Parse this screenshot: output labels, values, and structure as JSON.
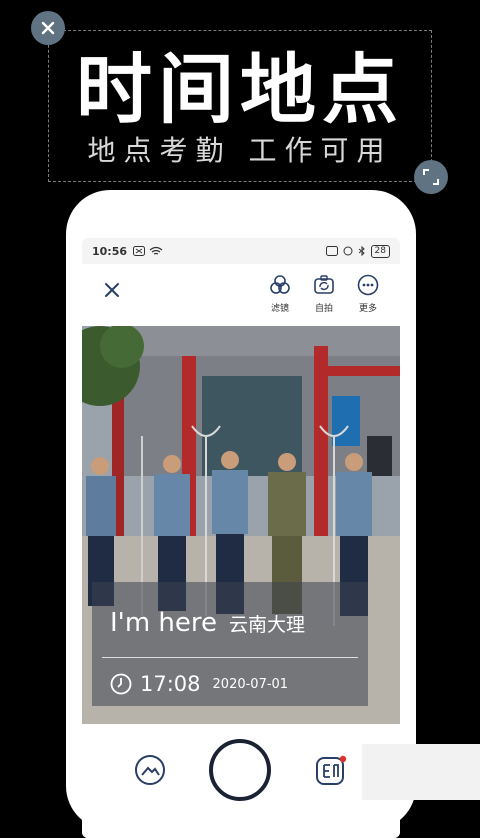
{
  "promo": {
    "title": "时间地点",
    "subtitle": "地点考勤 工作可用"
  },
  "status_bar": {
    "time": "10:56",
    "battery": "28"
  },
  "toolbar": {
    "filter_label": "滤镜",
    "selfie_label": "自拍",
    "more_label": "更多"
  },
  "overlay": {
    "heading": "I'm here",
    "location": "云南大理",
    "time": "17:08",
    "date": "2020-07-01"
  },
  "icons": {
    "close": "close-icon",
    "resize": "resize-icon",
    "filter": "filter-icon",
    "selfie": "selfie-rotate-icon",
    "more": "more-icon",
    "gallery": "gallery-icon",
    "shutter": "shutter-button",
    "stamp": "stamp-icon",
    "clock": "clock-icon"
  },
  "colors": {
    "accent": "#2a3f66",
    "badge": "#5f7383",
    "background": "#000000"
  }
}
